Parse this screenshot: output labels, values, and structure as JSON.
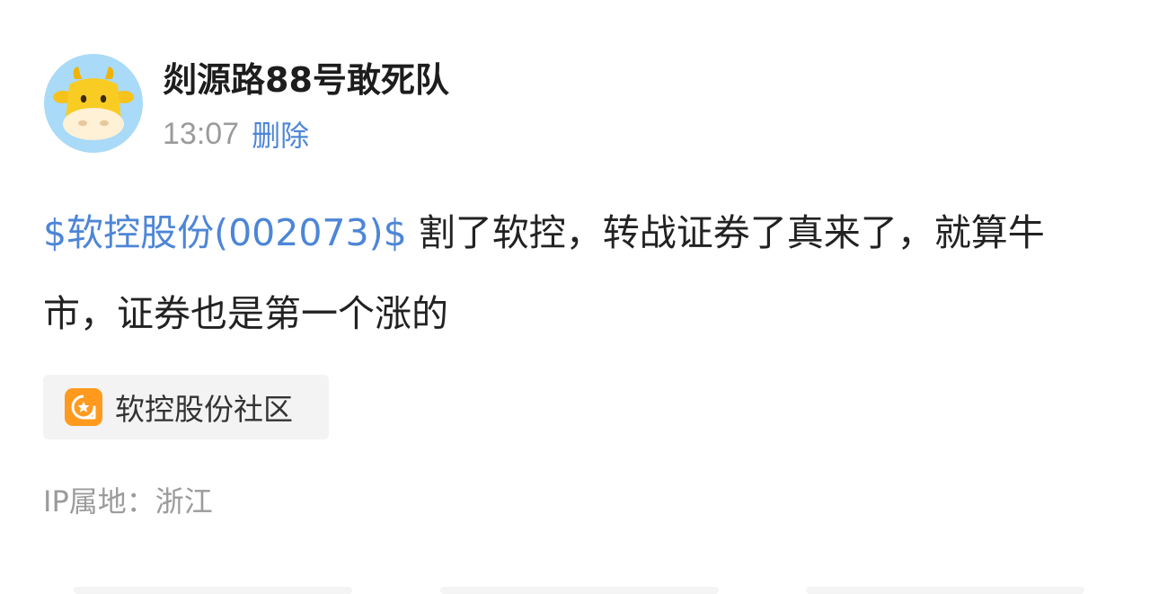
{
  "post": {
    "author": {
      "name": "剡源路88号敢死队"
    },
    "time": "13:07",
    "delete_label": "删除",
    "stock_tag": "$软控股份(002073)$",
    "content": " 割了软控，转战证券了真来了，就算牛市，证券也是第一个涨的",
    "community": {
      "label": "软控股份社区"
    },
    "ip_location": "IP属地：浙江"
  },
  "colors": {
    "link_blue": "#4d86d6",
    "community_orange": "#ff9a1f",
    "muted_gray": "#9b9b9b",
    "avatar_background": "#a9daf7",
    "chip_background": "#f3f3f3"
  },
  "icons": {
    "avatar": "cartoon-cow-avatar",
    "community": "community-star-icon"
  }
}
